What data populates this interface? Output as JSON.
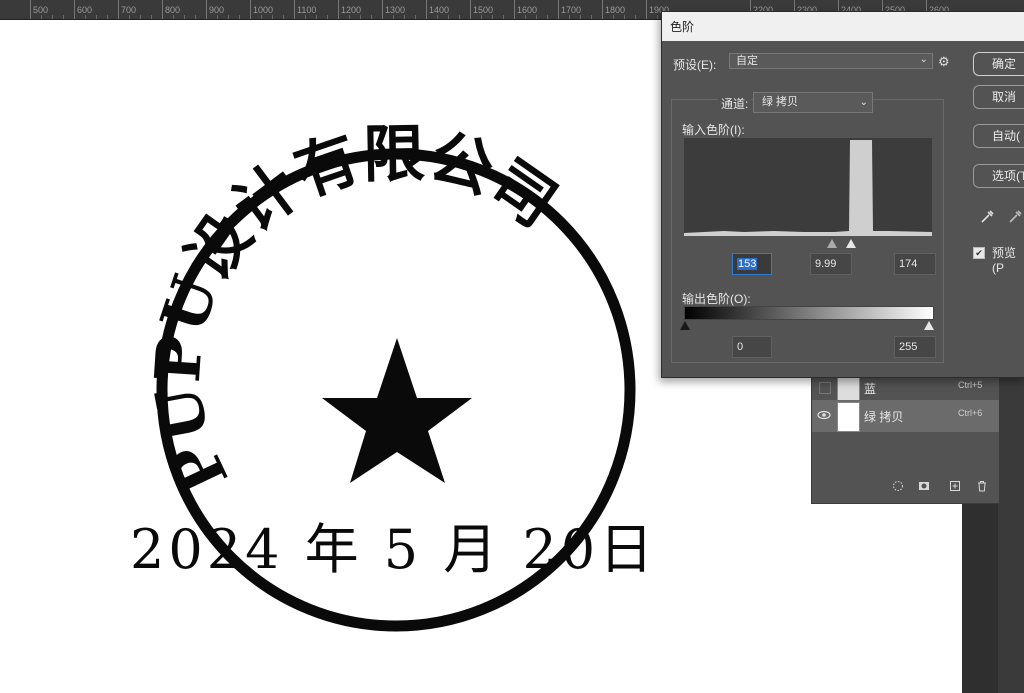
{
  "ruler": {
    "labels": [
      "500",
      "600",
      "700",
      "800",
      "900",
      "1000",
      "1100",
      "1200",
      "1300",
      "1400",
      "1500",
      "1600",
      "1700",
      "1800",
      "1900",
      "2200",
      "2300",
      "2400",
      "2500",
      "2600"
    ]
  },
  "stamp": {
    "ring_text": "PUPU设计有限公司",
    "date_text": "2024 年 5 月 20日"
  },
  "levels_dialog": {
    "title": "色阶",
    "preset_label": "预设(E):",
    "preset_value": "自定",
    "channel_label": "通道:",
    "channel_value": "绿 拷贝",
    "input_levels_label": "输入色阶(I):",
    "input_black": "153",
    "input_gamma": "9.99",
    "input_white": "174",
    "output_levels_label": "输出色阶(O):",
    "output_black": "0",
    "output_white": "255",
    "buttons": {
      "ok": "确定",
      "cancel": "取消",
      "auto": "自动(",
      "options": "选项(T"
    },
    "preview_label": "预览(P",
    "preview_checked": true
  },
  "layers_panel": {
    "layers": [
      {
        "name": "蓝",
        "shortcut": "Ctrl+5",
        "visible": false,
        "selected": false
      },
      {
        "name": "绿 拷贝",
        "shortcut": "Ctrl+6",
        "visible": true,
        "selected": true
      }
    ],
    "icons": [
      "dotted-circle-icon",
      "mask-icon",
      "new-layer-icon",
      "trash-icon"
    ]
  },
  "colors": {
    "panel_bg": "#535353",
    "selection_blue": "#2b6ec9"
  }
}
